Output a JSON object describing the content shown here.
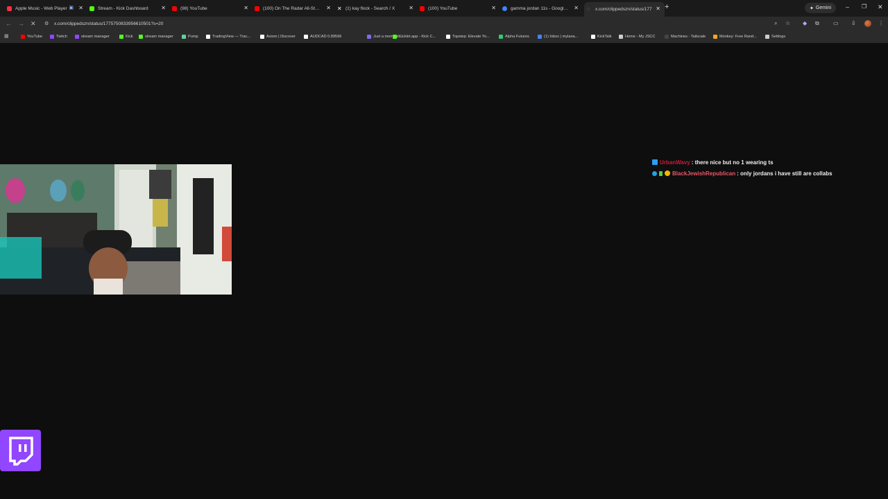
{
  "tabs": [
    {
      "title": "Apple Music - Web Player",
      "color": "#fa2d48"
    },
    {
      "title": "Stream - Kick Dashboard",
      "color": "#53fc18"
    },
    {
      "title": "(98) YouTube",
      "color": "#ff0000"
    },
    {
      "title": "(100) On The Radar All-Star Cy",
      "color": "#ff0000"
    },
    {
      "title": "(1) kay flock - Search / X",
      "color": "#ffffff"
    },
    {
      "title": "(100) YouTube",
      "color": "#ff0000"
    },
    {
      "title": "gamma jordan 11s - Google Se",
      "color": "#4285f4"
    },
    {
      "title": "x.com/clippedszn/status/177",
      "color": "#ffffff"
    }
  ],
  "gemini_label": "Gemini",
  "address": "x.com/clippedszn/status/1775750833956610501?s=20",
  "bookmarks": [
    {
      "label": "YouTube",
      "color": "#ff0000"
    },
    {
      "label": "Twitch",
      "color": "#9146ff"
    },
    {
      "label": "stream manager",
      "color": "#9146ff"
    },
    {
      "label": "Kick",
      "color": "#53fc18"
    },
    {
      "label": "stream manager",
      "color": "#53fc18"
    },
    {
      "label": "Pump",
      "color": "#5dd39e"
    },
    {
      "label": "TradingView — Trac...",
      "color": "#ffffff"
    },
    {
      "label": "Axiom | Discover",
      "color": "#ffffff"
    },
    {
      "label": "AUDCAD 0.89596",
      "color": "#ffffff"
    },
    {
      "label": "Just a moment...",
      "color": "#7b6cf6"
    },
    {
      "label": "Kicklet.app - Kick C...",
      "color": "#53fc18"
    },
    {
      "label": "Topstep: Elevate Yo...",
      "color": "#ffffff"
    },
    {
      "label": "Alpha Futures",
      "color": "#2ecc71"
    },
    {
      "label": "(1) Inbox | mylana...",
      "color": "#4285f4"
    },
    {
      "label": "KickTalk",
      "color": "#ffffff"
    },
    {
      "label": "Home - My JSCC",
      "color": "#cccccc"
    },
    {
      "label": "Machines - Tailscale",
      "color": "#444444"
    },
    {
      "label": "Monkey: Free Rand...",
      "color": "#f5a623"
    },
    {
      "label": "Settings",
      "color": "#cccccc"
    }
  ],
  "chat": [
    {
      "user": "UrbanWavy",
      "user_color": "#c0213a",
      "message": ": there nice but no 1 wearing ts"
    },
    {
      "user": "BlackJewishRepublican",
      "user_color": "#e8576a",
      "message": ": only jordans i have still are collabs"
    }
  ]
}
